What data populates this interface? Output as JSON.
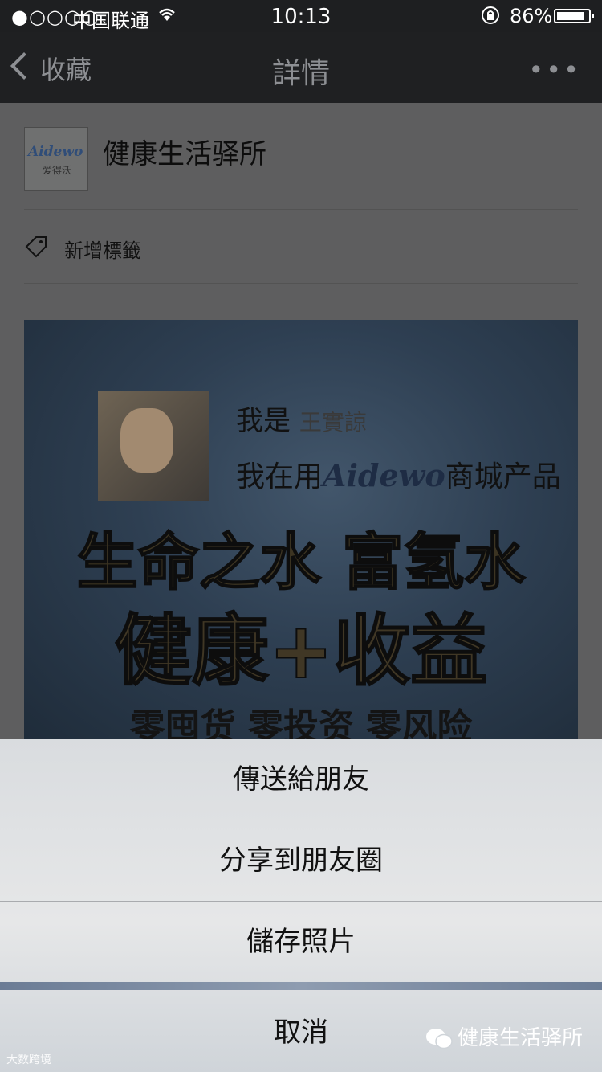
{
  "status_bar": {
    "signal": "●○○○○",
    "carrier": "中国联通",
    "time": "10:13",
    "battery_pct": "86%",
    "battery_level": 0.86
  },
  "nav": {
    "back_label": "收藏",
    "title": "詳情",
    "more": "•••"
  },
  "account": {
    "logo_brand": "Aidewo",
    "logo_sub": "爱得沃",
    "name": "健康生活驿所"
  },
  "tag": {
    "label": "新增標籤"
  },
  "poster": {
    "i_am": "我是",
    "person_name": "王實諒",
    "i_use_prefix": "我在用",
    "brand": "Aidewo",
    "i_use_suffix": "商城产品",
    "headline_1": "生命之水 富氢水",
    "headline_2": "健康+收益",
    "headline_3": "零囤货 零投资 零风险"
  },
  "action_sheet": {
    "items": [
      {
        "label": "傳送給朋友"
      },
      {
        "label": "分享到朋友圈"
      },
      {
        "label": "儲存照片"
      }
    ],
    "cancel": "取消"
  },
  "watermark": {
    "text": "健康生活驿所",
    "corner": "大数跨境"
  },
  "colors": {
    "sheet_bg": "#e6e7e8",
    "overlay": "#5e5e5f"
  }
}
